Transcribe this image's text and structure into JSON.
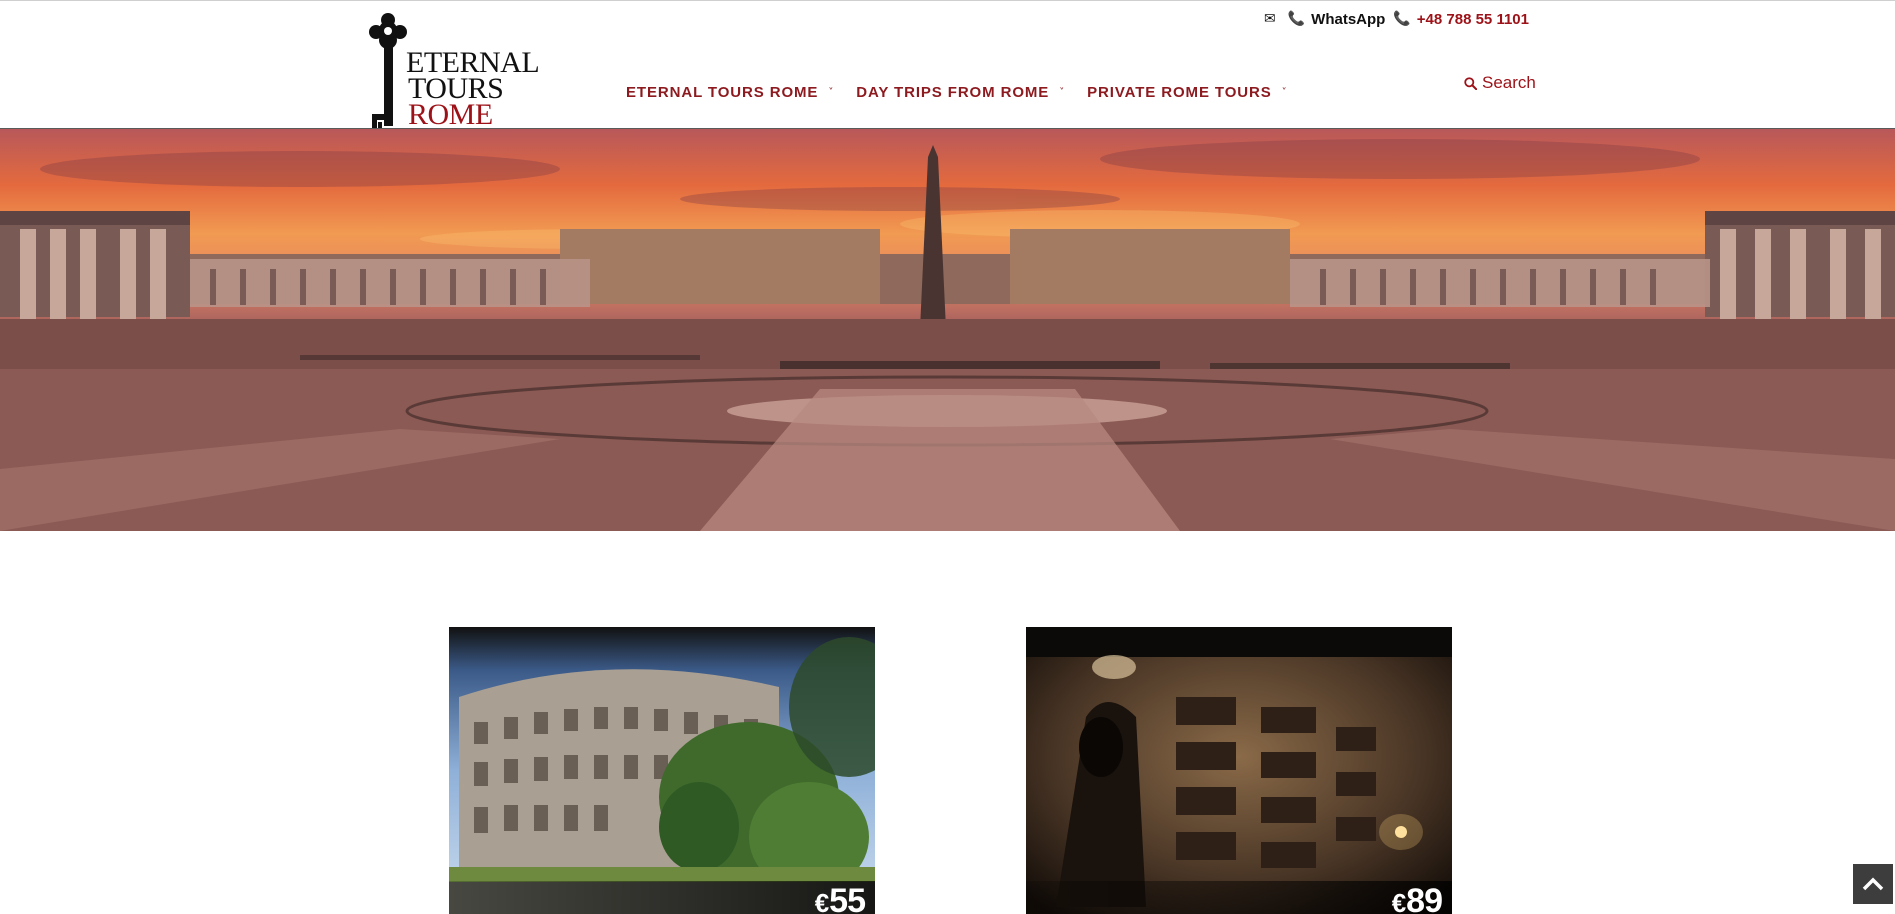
{
  "header": {
    "logo": {
      "line1": "ETERNAL",
      "line2": "TOURS",
      "line3": "ROME",
      "icon": "skeleton-key-icon"
    },
    "contact": {
      "email_icon": "envelope-icon",
      "whatsapp_icon": "phone-icon",
      "whatsapp_label": "WhatsApp",
      "phone_icon": "phone-icon",
      "phone_number": "+48 788 55 1101"
    },
    "nav": [
      {
        "label": "ETERNAL TOURS ROME",
        "icon": "chevron-down-icon"
      },
      {
        "label": "DAY TRIPS FROM ROME",
        "icon": "chevron-down-icon"
      },
      {
        "label": "PRIVATE ROME TOURS",
        "icon": "chevron-down-icon"
      }
    ],
    "search_label": "Search",
    "search_icon": "search-icon"
  },
  "hero": {
    "slide_indicators": [
      {
        "state": "inactive"
      },
      {
        "state": "active"
      }
    ],
    "colors": {
      "active": "#9c1218",
      "inactive": "#ffffff"
    }
  },
  "tours": [
    {
      "currency": "€",
      "price": "55"
    },
    {
      "currency": "€",
      "price": "89"
    }
  ],
  "back_to_top_icon": "chevron-up-icon",
  "colors": {
    "brand": "#9c1218",
    "nav": "#8c1a1f"
  }
}
